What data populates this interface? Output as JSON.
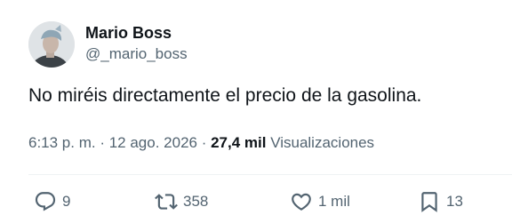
{
  "author": {
    "display_name": "Mario Boss",
    "handle": "@_mario_boss"
  },
  "tweet": {
    "text": "No miréis directamente el precio de la gasolina."
  },
  "meta": {
    "time": "6:13 p. m.",
    "separator1": " · ",
    "date": "12 ago. 2026",
    "separator2": " · ",
    "views_count": "27,4 mil",
    "views_label": " Visualizaciones"
  },
  "actions": {
    "replies": "9",
    "retweets": "358",
    "likes": "1 mil",
    "bookmarks": "13"
  },
  "colors": {
    "text": "#0f1419",
    "secondary": "#536471",
    "background": "#ffffff"
  },
  "icons": [
    "avatar",
    "reply-icon",
    "retweet-icon",
    "like-icon",
    "bookmark-icon"
  ]
}
